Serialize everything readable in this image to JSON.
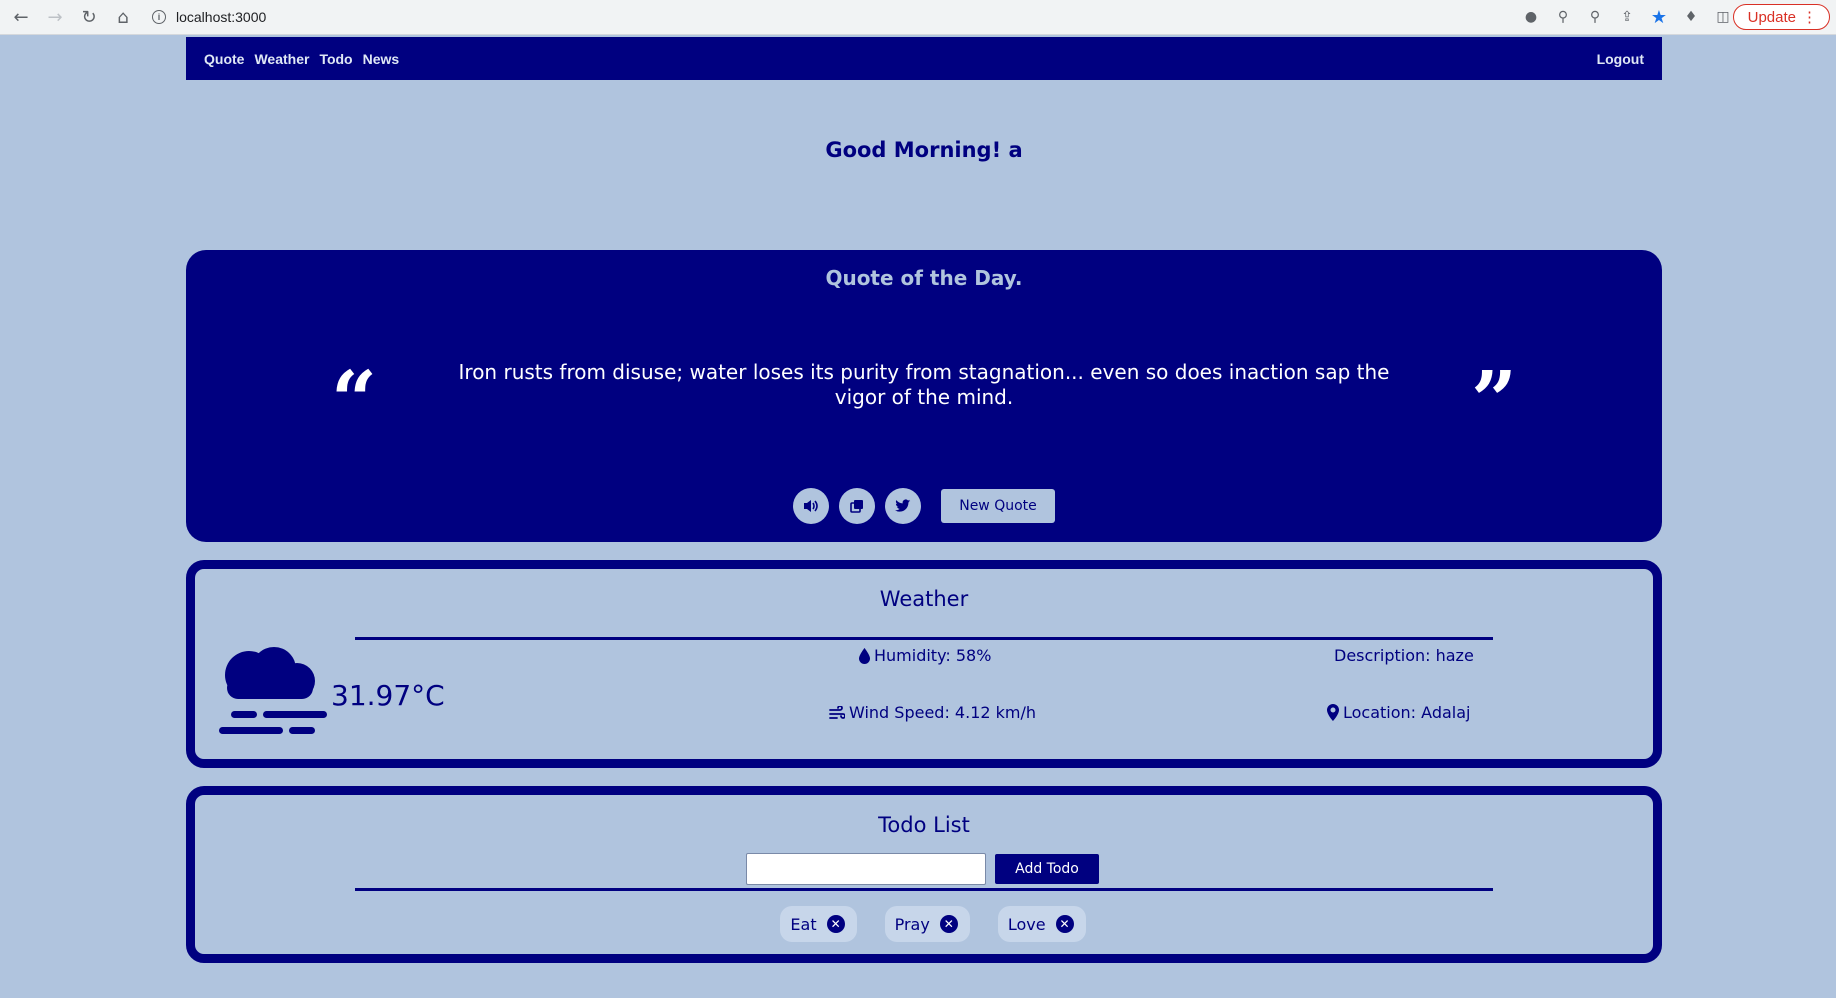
{
  "browser": {
    "url": "localhost:3000",
    "update_label": "Update"
  },
  "nav": {
    "links": [
      "Quote",
      "Weather",
      "Todo",
      "News"
    ],
    "logout": "Logout"
  },
  "greeting": "Good Morning! a",
  "quote": {
    "heading": "Quote of the Day.",
    "text": "Iron rusts from disuse; water loses its purity from stagnation... even so does inaction sap the vigor of the mind.",
    "new_quote_label": "New Quote"
  },
  "weather": {
    "heading": "Weather",
    "temperature": "31.97°C",
    "humidity": "Humidity: 58%",
    "wind": "Wind Speed: 4.12 km/h",
    "description": "Description: haze",
    "location": "Location: Adalaj"
  },
  "todo": {
    "heading": "Todo List",
    "input_value": "",
    "add_label": "Add Todo",
    "items": [
      "Eat",
      "Pray",
      "Love"
    ]
  },
  "colors": {
    "page_bg": "#b0c4de",
    "primary": "#000080"
  }
}
